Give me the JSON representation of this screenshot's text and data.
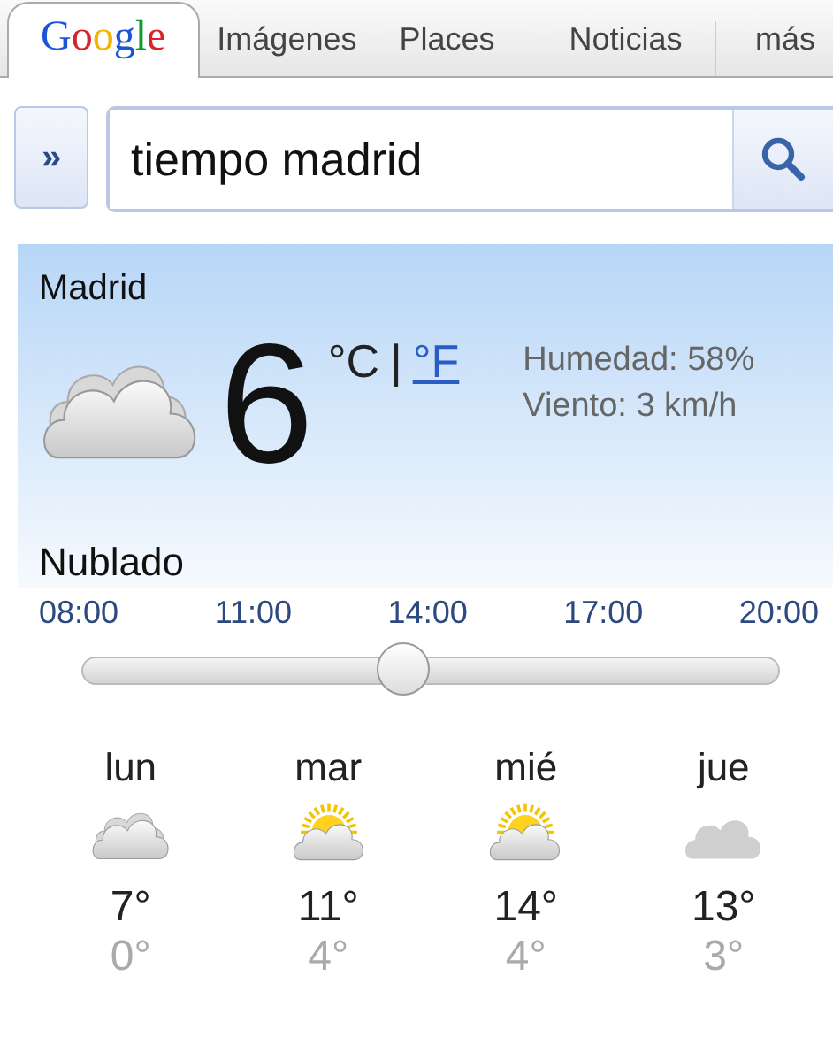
{
  "tabs": [
    {
      "label": "Google",
      "kind": "logo",
      "selected": true
    },
    {
      "label": "Imágenes",
      "kind": "text",
      "selected": false
    },
    {
      "label": "Places",
      "kind": "text",
      "selected": false
    },
    {
      "label": "Noticias",
      "kind": "text",
      "selected": false
    },
    {
      "label": "más",
      "kind": "text",
      "selected": false
    }
  ],
  "search": {
    "expand_label": "»",
    "value": "tiempo madrid"
  },
  "current": {
    "city": "Madrid",
    "icon": {
      "kind": "cloudy"
    },
    "temperature": "6",
    "unit_celsius": "°C",
    "unit_separator": "|",
    "unit_fahrenheit": "°F",
    "humidity": "Humedad: 58%",
    "wind": "Viento: 3 km/h",
    "condition": "Nublado"
  },
  "hourly": {
    "times": [
      "08:00",
      "11:00",
      "14:00",
      "17:00",
      "20:00"
    ],
    "level": 0.46
  },
  "forecast": [
    {
      "day": "lun",
      "kind": "cloudy",
      "high": "7°",
      "low": "0°"
    },
    {
      "day": "mar",
      "kind": "partly_sunny",
      "high": "11°",
      "low": "4°"
    },
    {
      "day": "mié",
      "kind": "partly_sunny",
      "high": "14°",
      "low": "4°"
    },
    {
      "day": "jue",
      "kind": "overcast",
      "high": "13°",
      "low": "3°"
    }
  ]
}
